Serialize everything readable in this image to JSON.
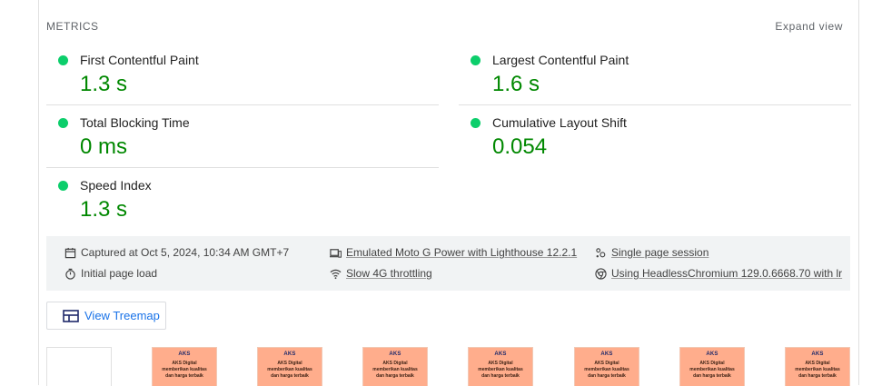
{
  "header": {
    "title": "METRICS",
    "expand_label": "Expand view"
  },
  "status_color": "#0cce6b",
  "metrics_left": [
    {
      "label": "First Contentful Paint",
      "value": "1.3 s",
      "status": "pass"
    },
    {
      "label": "Total Blocking Time",
      "value": "0 ms",
      "status": "pass"
    },
    {
      "label": "Speed Index",
      "value": "1.3 s",
      "status": "pass"
    }
  ],
  "metrics_right": [
    {
      "label": "Largest Contentful Paint",
      "value": "1.6 s",
      "status": "pass"
    },
    {
      "label": "Cumulative Layout Shift",
      "value": "0.054",
      "status": "pass"
    }
  ],
  "runtime_info": {
    "captured": {
      "icon": "calendar-icon",
      "text": "Captured at Oct 5, 2024, 10:34 AM GMT+7"
    },
    "initial_load": {
      "icon": "timer-icon",
      "text": "Initial page load"
    },
    "device": {
      "icon": "devices-icon",
      "text": "Emulated Moto G Power with Lighthouse 12.2.1"
    },
    "throttling": {
      "icon": "wifi-icon",
      "text": "Slow 4G throttling"
    },
    "session": {
      "icon": "session-icon",
      "text": "Single page session"
    },
    "browser": {
      "icon": "chrome-icon",
      "text": "Using HeadlessChromium 129.0.6668.70 with lr"
    }
  },
  "treemap": {
    "icon": "treemap-icon",
    "label": "View Treemap"
  },
  "filmstrip": {
    "frames": [
      {
        "logo": "AKS",
        "line1": "AKS Digital",
        "line2": "memberikan kualitas",
        "line3": "dan harga terbaik"
      },
      {
        "logo": "AKS",
        "line1": "AKS Digital",
        "line2": "memberikan kualitas",
        "line3": "dan harga terbaik"
      },
      {
        "logo": "AKS",
        "line1": "AKS Digital",
        "line2": "memberikan kualitas",
        "line3": "dan harga terbaik"
      },
      {
        "logo": "AKS",
        "line1": "AKS Digital",
        "line2": "memberikan kualitas",
        "line3": "dan harga terbaik"
      },
      {
        "logo": "AKS",
        "line1": "AKS Digital",
        "line2": "memberikan kualitas",
        "line3": "dan harga terbaik"
      },
      {
        "logo": "AKS",
        "line1": "AKS Digital",
        "line2": "memberikan kualitas",
        "line3": "dan harga terbaik"
      },
      {
        "logo": "AKS",
        "line1": "AKS Digital",
        "line2": "memberikan kualitas",
        "line3": "dan harga terbaik"
      }
    ]
  }
}
